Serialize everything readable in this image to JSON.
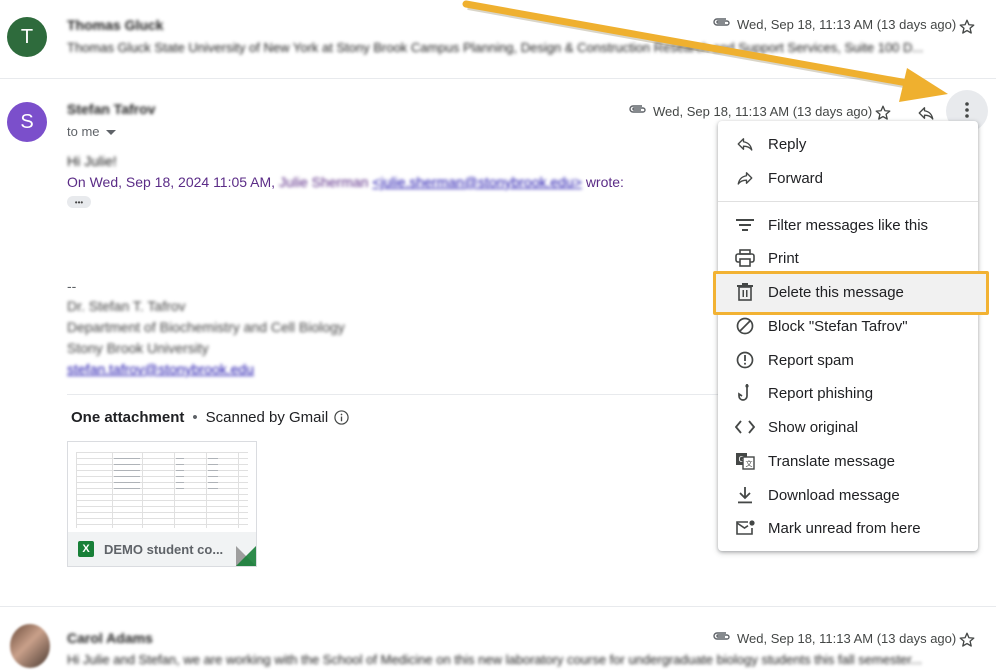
{
  "messages": [
    {
      "avatar_letter": "T",
      "avatar_color": "#2e6b3c",
      "sender": "Thomas Gluck",
      "snippet": "Thomas Gluck State University of New York at Stony Brook Campus Planning, Design & Construction Research and Support Services, Suite 100 D...",
      "date": "Wed, Sep 18, 11:13 AM (13 days ago)"
    },
    {
      "avatar_letter": "S",
      "avatar_color": "#7b4fcb",
      "sender": "Stefan Tafrov",
      "recipient": "to me",
      "date": "Wed, Sep 18, 11:13 AM (13 days ago)",
      "greeting": "Hi Julie!",
      "quote_prefix": "On Wed, Sep 18, 2024 11:05 AM,",
      "quote_name": "Julie Sherman",
      "quote_email": "<julie.sherman@stonybrook.edu>",
      "quote_suffix": "wrote:",
      "ellipsis": "•••",
      "sig_dash": "--",
      "sig_name": "Dr. Stefan T. Tafrov",
      "sig_dept": "Department of Biochemistry and Cell Biology",
      "sig_uni": "Stony Brook University",
      "sig_email": "stefan.tafrov@stonybrook.edu",
      "attachment_header": "One attachment",
      "scanned_by": "Scanned by Gmail",
      "attachment_name": "DEMO student co...",
      "attachment_type_badge": "X"
    },
    {
      "sender": "Carol Adams",
      "snippet": "Hi Julie and Stefan, we are working with the School of Medicine on this new laboratory course for undergraduate biology students this fall semester...",
      "date": "Wed, Sep 18, 11:13 AM (13 days ago)"
    }
  ],
  "menu": {
    "items": [
      {
        "label": "Reply",
        "icon": "reply-icon"
      },
      {
        "label": "Forward",
        "icon": "forward-icon"
      },
      {
        "label": "Filter messages like this",
        "icon": "filter-icon"
      },
      {
        "label": "Print",
        "icon": "print-icon"
      },
      {
        "label": "Delete this message",
        "icon": "trash-icon"
      },
      {
        "label": "Block \"Stefan Tafrov\"",
        "icon": "block-icon"
      },
      {
        "label": "Report spam",
        "icon": "spam-icon"
      },
      {
        "label": "Report phishing",
        "icon": "phishing-icon"
      },
      {
        "label": "Show original",
        "icon": "code-icon"
      },
      {
        "label": "Translate message",
        "icon": "translate-icon"
      },
      {
        "label": "Download message",
        "icon": "download-icon"
      },
      {
        "label": "Mark unread from here",
        "icon": "mark-unread-icon"
      }
    ]
  },
  "colors": {
    "highlight": "#f2b233",
    "link": "#1a0dab",
    "quote": "#5b2c87",
    "excel_green": "#188038"
  }
}
